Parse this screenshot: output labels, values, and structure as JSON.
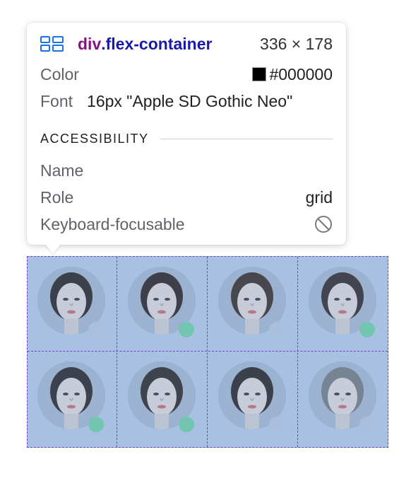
{
  "tooltip": {
    "selector_tag": "div",
    "selector_class": ".flex-container",
    "dimensions": "336 × 178",
    "color_label": "Color",
    "color_value": "#000000",
    "font_label": "Font",
    "font_value": "16px \"Apple SD Gothic Neo\"",
    "accessibility_title": "ACCESSIBILITY",
    "name_label": "Name",
    "role_label": "Role",
    "role_value": "grid",
    "keyboard_label": "Keyboard-focusable"
  },
  "grid": {
    "avatars": [
      {
        "status": "offline",
        "status_color": "#a9bfdc"
      },
      {
        "status": "online",
        "status_color": "#72c6b0"
      },
      {
        "status": "offline",
        "status_color": "#a9bfdc"
      },
      {
        "status": "online",
        "status_color": "#72c6b0"
      },
      {
        "status": "online",
        "status_color": "#72c6b0"
      },
      {
        "status": "online",
        "status_color": "#72c6b0"
      },
      {
        "status": "offline",
        "status_color": "#a9bfdc"
      },
      {
        "status": "offline",
        "status_color": "#a9bfdc"
      }
    ]
  },
  "colors": {
    "highlight_fill": "#a8c0e2",
    "highlight_border": "#7b3fd1",
    "tag_color": "#881280",
    "class_color": "#1a1aa6"
  }
}
